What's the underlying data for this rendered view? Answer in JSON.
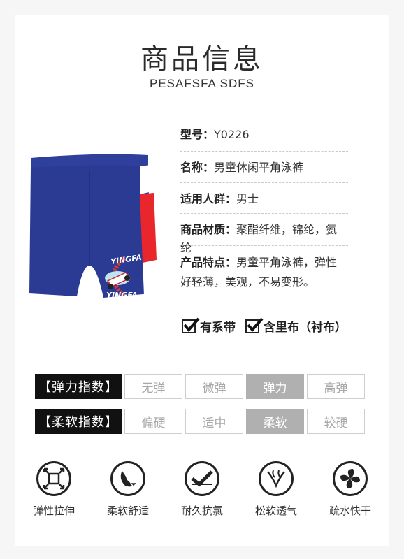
{
  "header": {
    "title": "商品信息",
    "subtitle": "PESAFSFA SDFS"
  },
  "product": {
    "print_text_top": "YINGFA",
    "print_text_bottom": "YINGFA",
    "colors": {
      "main": "#2b3b94",
      "stripe_red": "#e8262c",
      "stripe_white": "#ffffff"
    }
  },
  "specs": [
    {
      "key": "型号：",
      "value": "Y0226"
    },
    {
      "key": "名称：",
      "value": "男童休闲平角泳裤"
    },
    {
      "key": "适用人群：",
      "value": "男士"
    },
    {
      "key": "商品材质：",
      "value": "聚酯纤维，锦纶，氨纶"
    },
    {
      "key": "产品特点：",
      "value": "男童平角泳裤，弹性好轻薄，美观，不易变形。"
    }
  ],
  "checks": [
    {
      "label": "有系带"
    },
    {
      "label": "含里布（衬布）"
    }
  ],
  "elasticity": {
    "label": "【弹力指数】",
    "options": [
      "无弹",
      "微弹",
      "弹力",
      "高弹"
    ],
    "selected": "弹力"
  },
  "softness": {
    "label": "【柔软指数】",
    "options": [
      "偏硬",
      "适中",
      "柔软",
      "较硬"
    ],
    "selected": "柔软"
  },
  "features": [
    {
      "label": "弹性拉伸",
      "icon": "stretch-icon"
    },
    {
      "label": "柔软舒适",
      "icon": "feather-icon"
    },
    {
      "label": "耐久抗氯",
      "icon": "durable-icon"
    },
    {
      "label": "松软透气",
      "icon": "breathable-icon"
    },
    {
      "label": "疏水快干",
      "icon": "quick-dry-icon"
    }
  ]
}
